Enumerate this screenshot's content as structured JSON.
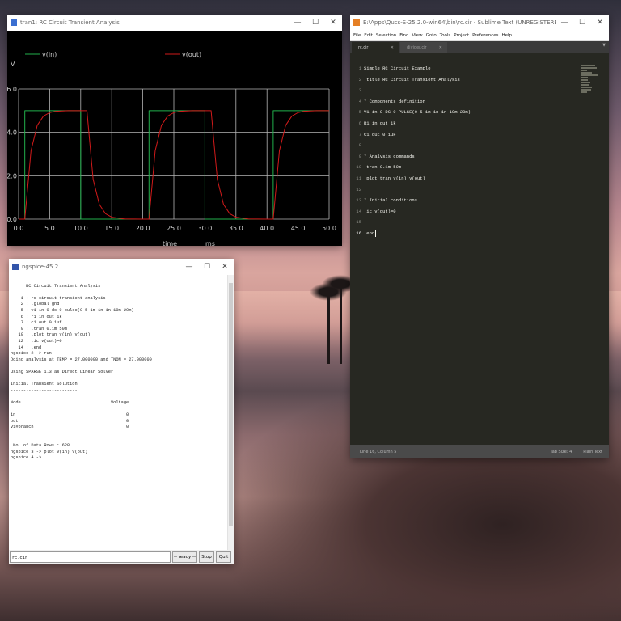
{
  "plot_window": {
    "title": "tran1: RC Circuit Transient Analysis",
    "controls": {
      "minimize": "—",
      "maximize": "☐",
      "close": "✕"
    }
  },
  "chart_data": {
    "type": "line",
    "title": "",
    "ylabel": "V",
    "xlabel": "time",
    "xunit": "ms",
    "xlim": [
      0,
      50
    ],
    "ylim": [
      0,
      6
    ],
    "xticks": [
      "0.0",
      "5.0",
      "10.0",
      "15.0",
      "20.0",
      "25.0",
      "30.0",
      "35.0",
      "40.0",
      "45.0",
      "50.0"
    ],
    "yticks": [
      "0.0",
      "2.0",
      "4.0",
      "6.0"
    ],
    "grid": true,
    "legend": "top",
    "series": [
      {
        "name": "v(in)",
        "color": "#22b14c",
        "x": [
          0,
          1,
          1.001,
          10,
          10.001,
          21,
          21.001,
          30,
          30.001,
          41,
          41.001,
          50
        ],
        "values": [
          0,
          0,
          5,
          5,
          0,
          0,
          5,
          5,
          0,
          0,
          5,
          5
        ]
      },
      {
        "name": "v(out)",
        "color": "#d11a1a",
        "x": [
          0,
          1,
          2,
          3,
          4,
          5,
          6,
          8,
          10,
          11,
          12,
          13,
          14,
          15,
          17,
          20,
          21,
          22,
          23,
          24,
          25,
          26,
          28,
          30,
          31,
          32,
          33,
          34,
          35,
          37,
          40,
          41,
          42,
          43,
          44,
          45,
          46,
          48,
          50
        ],
        "values": [
          0,
          0,
          3.16,
          4.32,
          4.75,
          4.91,
          4.97,
          5.0,
          5.0,
          5.0,
          1.84,
          0.68,
          0.25,
          0.09,
          0.01,
          0,
          0,
          3.16,
          4.32,
          4.75,
          4.91,
          4.97,
          5.0,
          5.0,
          5.0,
          1.84,
          0.68,
          0.25,
          0.09,
          0.01,
          0,
          0,
          3.16,
          4.32,
          4.75,
          4.91,
          4.97,
          5.0,
          5.0
        ]
      }
    ]
  },
  "ngspice_window": {
    "title": "ngspice-45.2",
    "console_lines": [
      "",
      "      RC Circuit Transient Analysis",
      "",
      "    1 : rc circuit transient analysis",
      "    2 : .global gnd",
      "    5 : v1 in 0 dc 0 pulse(0 5 1m 1n 1n 10m 20m)",
      "    6 : r1 in out 1k",
      "    7 : c1 out 0 1uf",
      "    9 : .tran 0.1m 50m",
      "   10 : .plot tran v(in) v(out)",
      "   12 : .ic v(out)=0",
      "   14 : .end",
      "ngspice 2 -> run",
      "Doing analysis at TEMP = 27.000000 and TNOM = 27.000000",
      "",
      "Using SPARSE 1.3 as Direct Linear Solver",
      "",
      "Initial Transient Solution",
      "--------------------------",
      "",
      "Node                                   Voltage",
      "----                                   -------",
      "in                                           0",
      "out                                          0",
      "v1#branch                                    0",
      "",
      "",
      " No. of Data Rows : 628",
      "ngspice 3 -> plot v(in) v(out)",
      "ngspice 4 ->"
    ],
    "command_value": "rc.cir",
    "status": "-- ready --",
    "stop_label": "Stop",
    "quit_label": "Quit"
  },
  "sublime_window": {
    "title": "E:\\Apps\\Qucs-S-25.2.0-win64\\bin\\rc.cir - Sublime Text (UNREGISTERED)",
    "menu": [
      "File",
      "Edit",
      "Selection",
      "Find",
      "View",
      "Goto",
      "Tools",
      "Project",
      "Preferences",
      "Help"
    ],
    "tabs": [
      {
        "label": "rc.cir",
        "active": true
      },
      {
        "label": "divider.cir",
        "active": false
      }
    ],
    "code_lines": [
      "Simple RC Circuit Example",
      ".title RC Circuit Transient Analysis",
      "",
      "* Components definition",
      "V1 in 0 DC 0 PULSE(0 5 1m 1n 1n 10m 20m)",
      "R1 in out 1k",
      "C1 out 0 1uF",
      "",
      "* Analysis commands",
      ".tran 0.1m 50m",
      ".plot tran v(in) v(out)",
      "",
      "* Initial conditions",
      ".ic v(out)=0",
      "",
      ".end"
    ],
    "line_numbers": [
      "1",
      "2",
      "3",
      "4",
      "5",
      "6",
      "7",
      "8",
      "9",
      "10",
      "11",
      "12",
      "13",
      "14",
      "15",
      "16"
    ],
    "status_position": "Line 16, Column 5",
    "status_tab": "Tab Size: 4",
    "status_syntax": "Plain Text"
  }
}
